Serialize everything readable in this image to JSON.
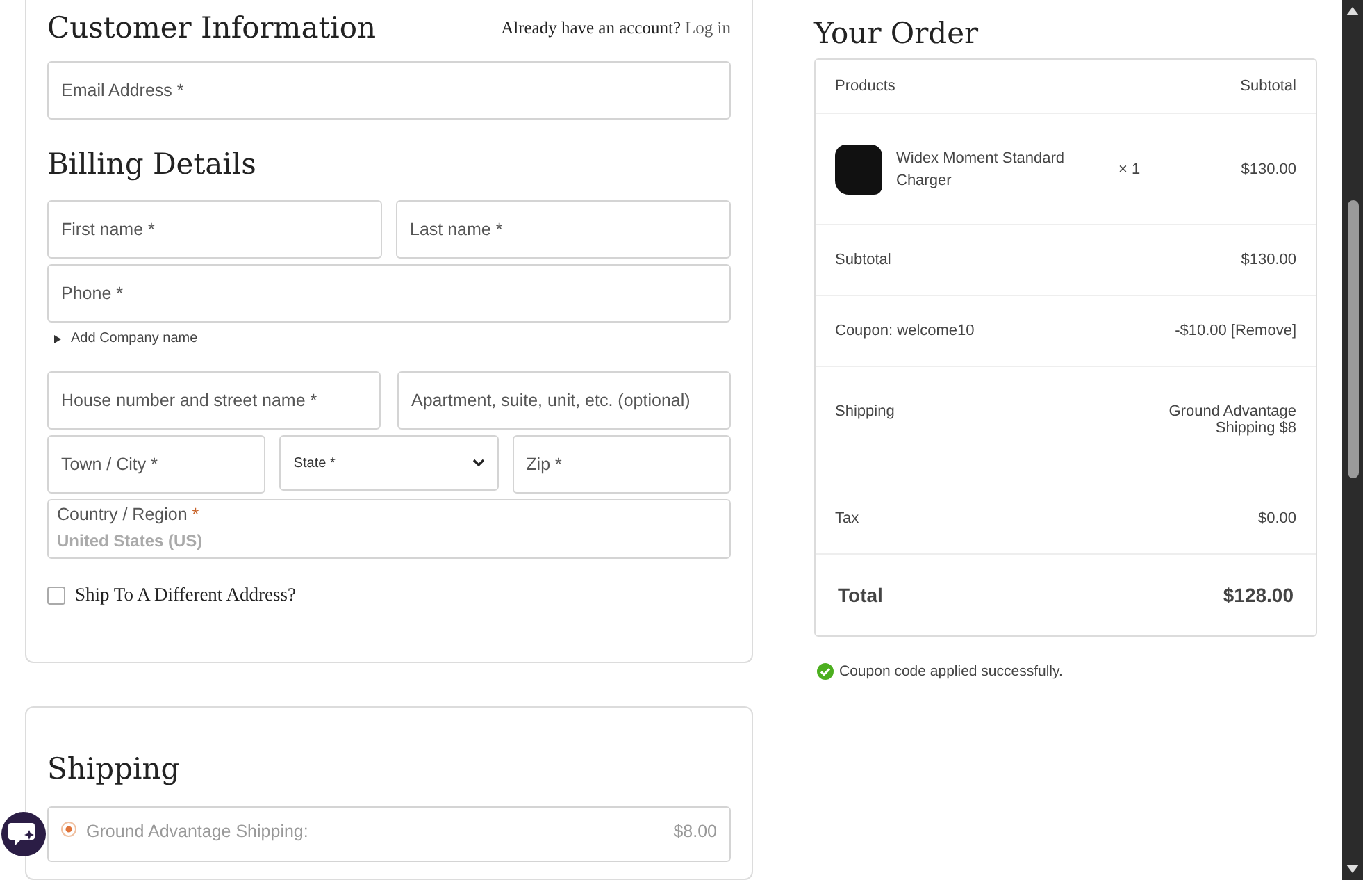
{
  "customer_information": {
    "title": "Customer Information",
    "account_prompt": "Already have an account?",
    "login_link": "Log in",
    "email_field": {
      "placeholder": "Email Address *"
    }
  },
  "billing_details": {
    "title": "Billing Details",
    "rows": [
      {
        "fields": [
          {
            "kind": "text",
            "placeholder": "First name *"
          },
          {
            "kind": "text",
            "placeholder": "Last name *"
          }
        ]
      },
      {
        "fields": [
          {
            "kind": "text",
            "placeholder": "Phone *"
          }
        ]
      },
      {
        "fields": [
          {
            "kind": "text",
            "placeholder": "House number and street name *"
          },
          {
            "kind": "text",
            "placeholder": "Apartment, suite, unit, etc. (optional)"
          }
        ]
      },
      {
        "fields": [
          {
            "kind": "text",
            "placeholder": "Town / City *"
          },
          {
            "kind": "select",
            "placeholder": "State *"
          },
          {
            "kind": "text",
            "placeholder": "Zip *"
          }
        ]
      }
    ],
    "add_company_link": "Add Company name",
    "country": {
      "label": "Country / Region",
      "required_mark": "*",
      "value": "United States (US)"
    },
    "ship_different": {
      "label": "Ship To A Different Address?",
      "checked": false
    }
  },
  "shipping": {
    "title": "Shipping",
    "options": [
      {
        "label": "Ground Advantage Shipping:",
        "price": "$8.00",
        "selected": true
      }
    ]
  },
  "order": {
    "title": "Your Order",
    "columns": [
      "Products",
      "Subtotal"
    ],
    "items": [
      {
        "name": "Widex Moment Standard Charger",
        "quantity": "× 1",
        "price": "$130.00"
      }
    ],
    "totals": [
      {
        "kind": "line",
        "label": "Subtotal",
        "value": "$130.00"
      },
      {
        "kind": "line",
        "label": "Coupon: welcome10",
        "value": "-$10.00",
        "link": "[Remove]"
      },
      {
        "kind": "line",
        "label": "Shipping",
        "value": "Ground Advantage Shipping $8"
      },
      {
        "kind": "line",
        "label": "Tax",
        "value": "$0.00"
      },
      {
        "kind": "total",
        "label": "Total",
        "value": "$128.00"
      }
    ],
    "coupon_message": "Coupon code applied successfully."
  }
}
